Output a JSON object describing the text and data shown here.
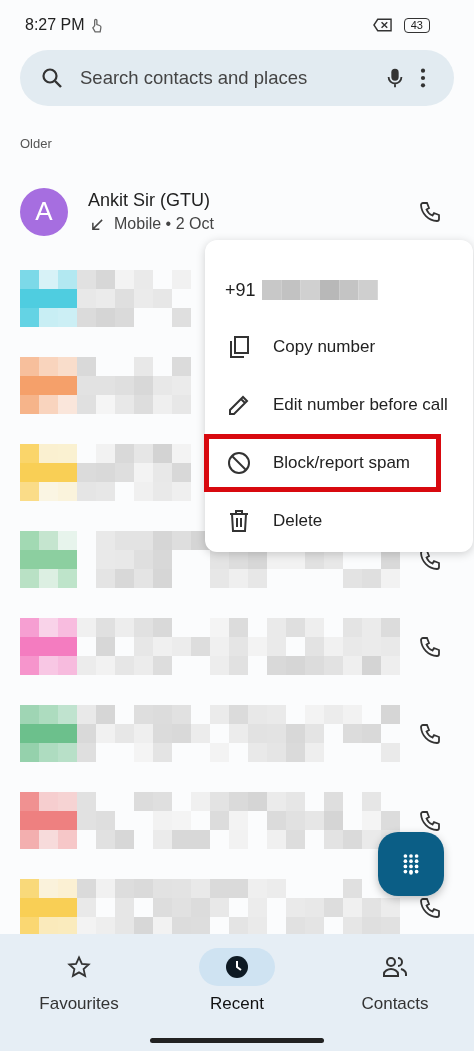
{
  "status_bar": {
    "time": "8:27 PM",
    "battery": "43"
  },
  "search": {
    "placeholder": "Search contacts and places"
  },
  "section": "Older",
  "calls": [
    {
      "kind": "contact",
      "initial": "A",
      "color": "#a66ee0",
      "name": "Ankit Sir (GTU)",
      "detail": "Mobile • 2 Oct",
      "covered": false
    },
    {
      "kind": "hidden",
      "color": "#4fcde0",
      "covered": true
    },
    {
      "kind": "hidden",
      "color": "#f5a06a",
      "covered": true
    },
    {
      "kind": "hidden",
      "color": "#f9cf55",
      "covered": true
    },
    {
      "kind": "hidden",
      "color": "#8ccfa0",
      "covered": false
    },
    {
      "kind": "hidden",
      "color": "#f47cc0",
      "covered": false
    },
    {
      "kind": "hidden",
      "color": "#6cc08c",
      "covered": false
    },
    {
      "kind": "hidden",
      "color": "#ee8080",
      "covered": false
    },
    {
      "kind": "hidden",
      "color": "#f9cf55",
      "covered": false
    }
  ],
  "menu": {
    "number": "+91",
    "items": [
      {
        "label": "Copy number",
        "kind": "copy",
        "highlighted": false
      },
      {
        "label": "Edit number before call",
        "kind": "edit",
        "highlighted": false
      },
      {
        "label": "Block/report spam",
        "kind": "block",
        "highlighted": true
      },
      {
        "label": "Delete",
        "kind": "delete",
        "highlighted": false
      }
    ]
  },
  "nav": [
    {
      "label": "Favourites",
      "kind": "favourites",
      "selected": false
    },
    {
      "label": "Recent",
      "kind": "recent",
      "selected": true
    },
    {
      "label": "Contacts",
      "kind": "contacts",
      "selected": false
    }
  ]
}
